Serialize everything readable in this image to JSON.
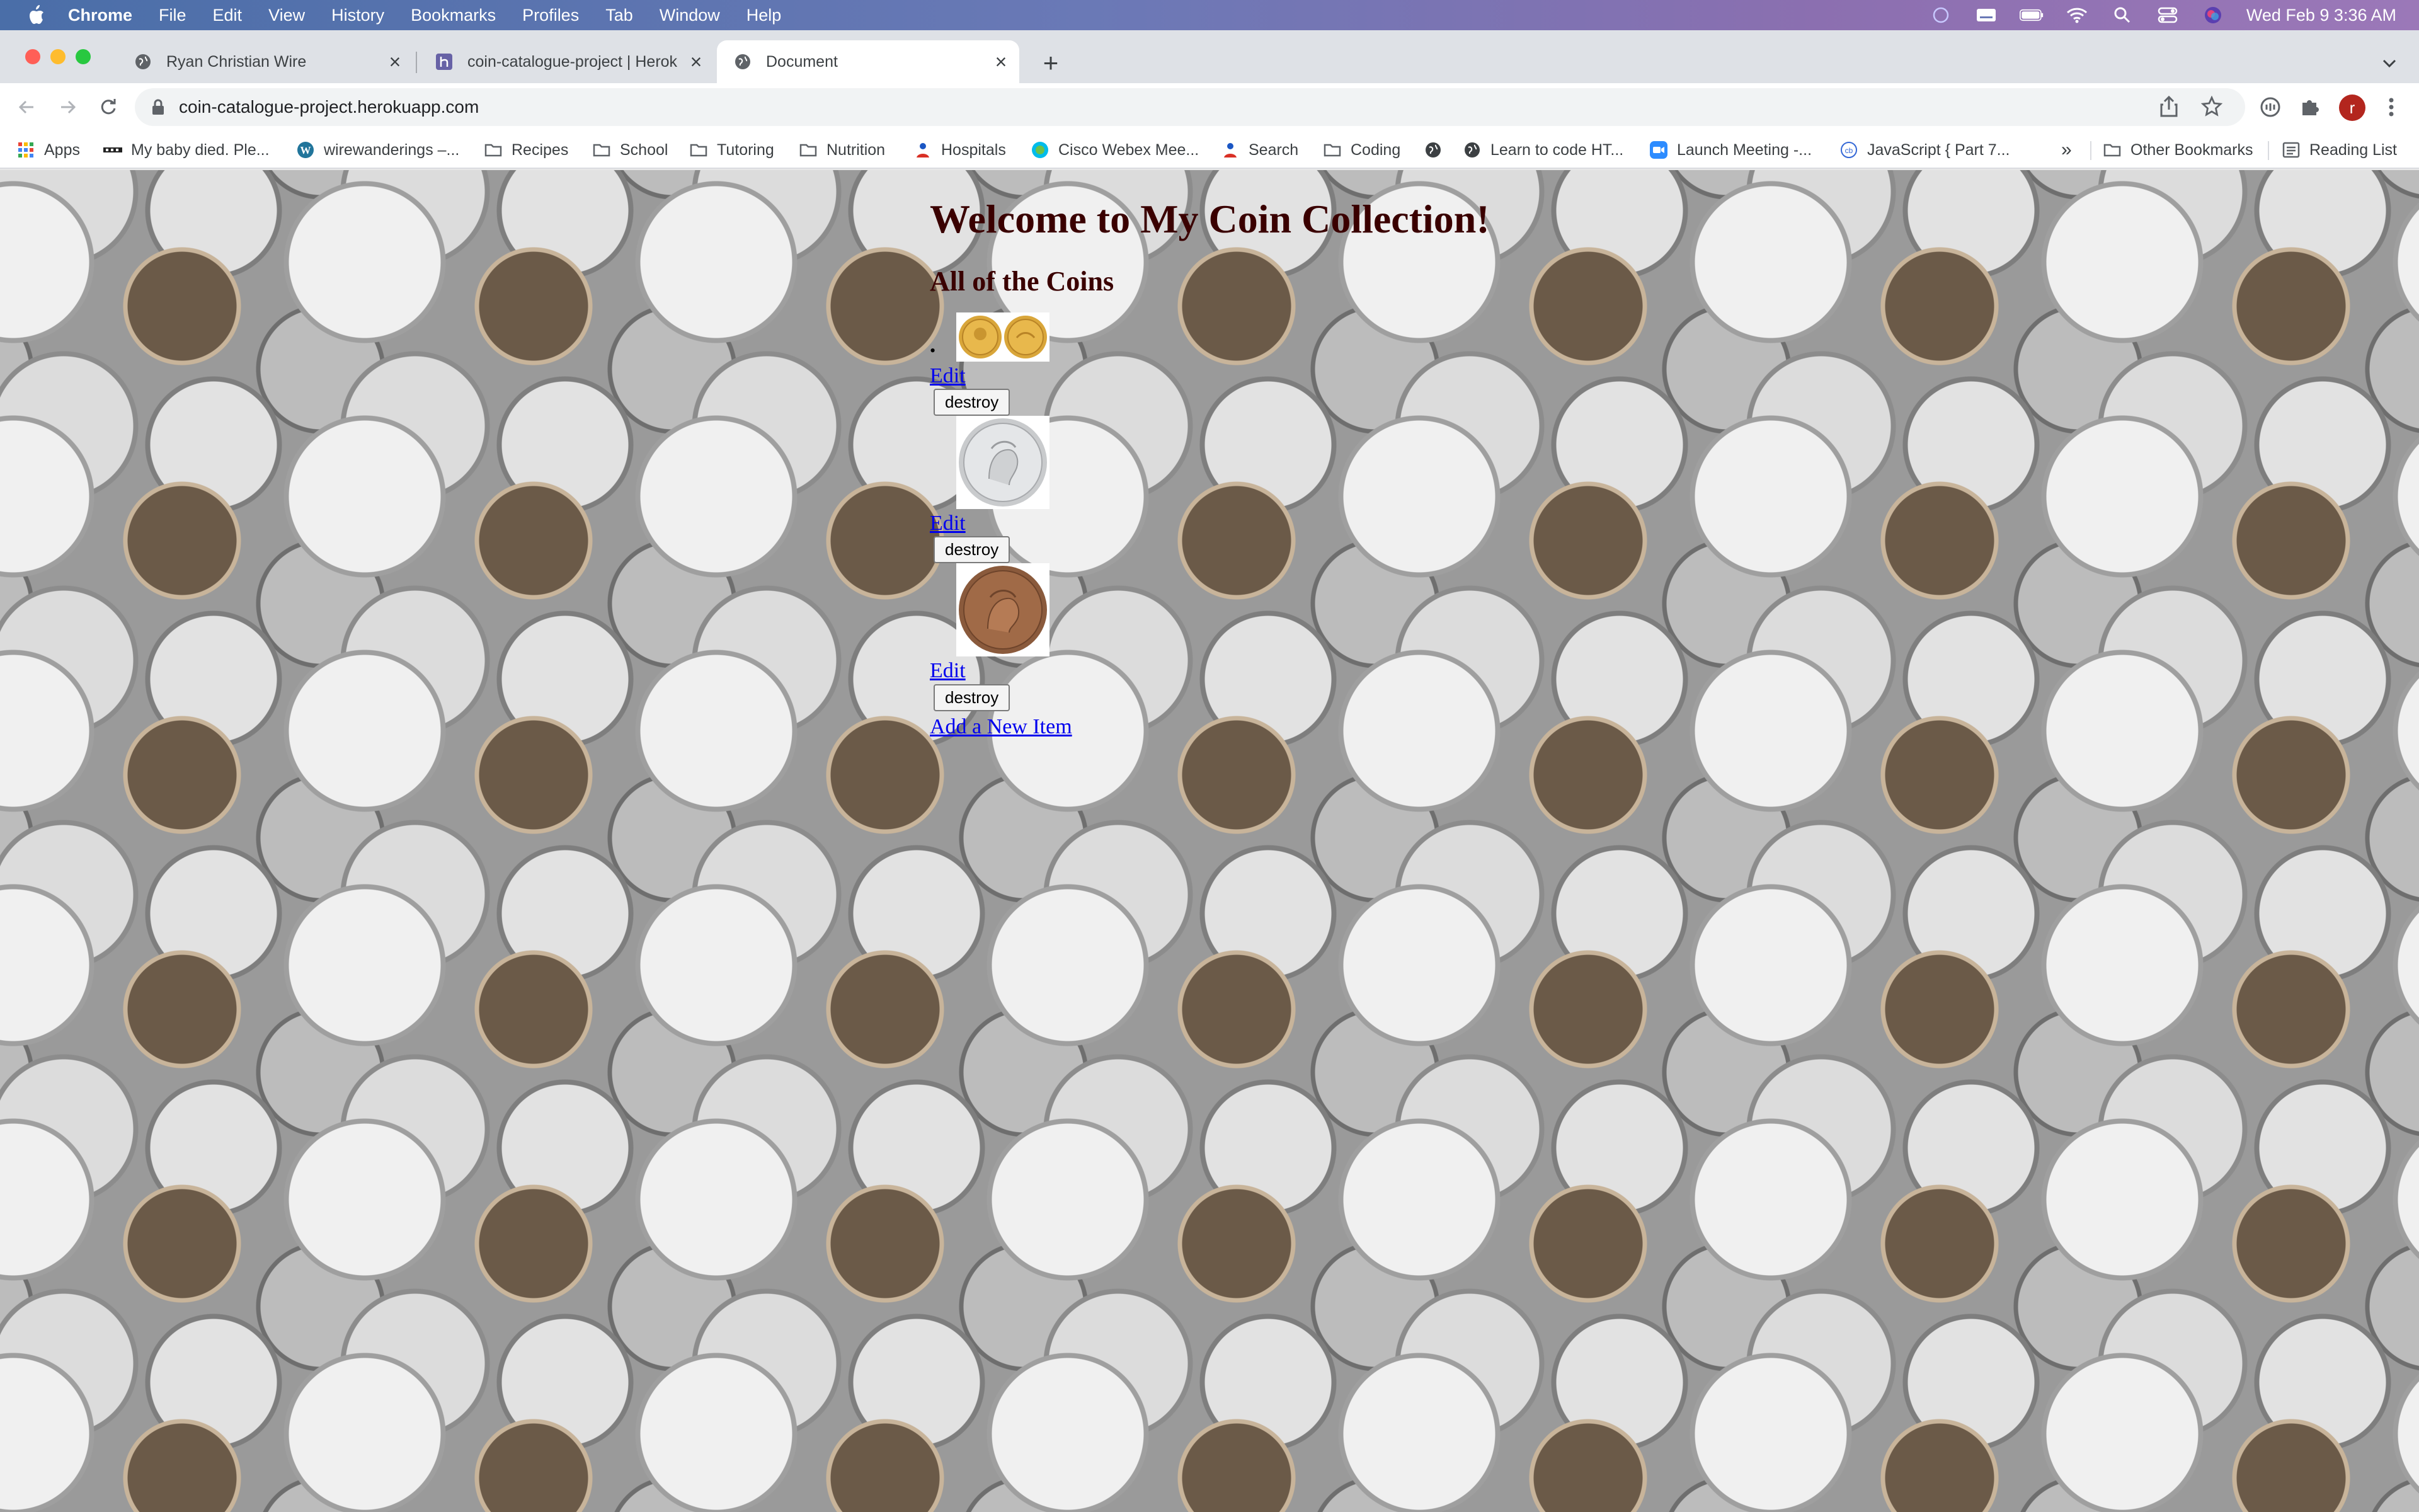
{
  "menubar": {
    "app_name": "Chrome",
    "menus": [
      "File",
      "Edit",
      "View",
      "History",
      "Bookmarks",
      "Profiles",
      "Tab",
      "Window",
      "Help"
    ],
    "clock": "Wed Feb 9  3:36 AM"
  },
  "tabs": [
    {
      "title": "Ryan Christian Wire",
      "icon": "globe-icon",
      "active": false
    },
    {
      "title": "coin-catalogue-project | Herok",
      "icon": "heroku-icon",
      "active": false
    },
    {
      "title": "Document",
      "icon": "globe-icon",
      "active": true
    }
  ],
  "toolbar": {
    "url": "coin-catalogue-project.herokuapp.com",
    "profile_initial": "r"
  },
  "bookmarks": {
    "items": [
      {
        "label": "Apps",
        "icon": "apps-grid-icon"
      },
      {
        "label": "My baby died. Ple...",
        "icon": "gofundme-icon"
      },
      {
        "label": "wirewanderings –...",
        "icon": "wordpress-icon"
      },
      {
        "label": "Recipes",
        "icon": "folder-icon"
      },
      {
        "label": "School",
        "icon": "folder-icon"
      },
      {
        "label": "Tutoring",
        "icon": "folder-icon"
      },
      {
        "label": "Nutrition",
        "icon": "folder-icon"
      },
      {
        "label": "Hospitals",
        "icon": "person-icon"
      },
      {
        "label": "Cisco Webex Mee...",
        "icon": "webex-icon"
      },
      {
        "label": "Search",
        "icon": "person-icon"
      },
      {
        "label": "Coding",
        "icon": "folder-icon"
      },
      {
        "label": "",
        "icon": "globe-icon"
      },
      {
        "label": "Learn to code HT...",
        "icon": "globe-icon"
      },
      {
        "label": "Launch Meeting -...",
        "icon": "zoom-icon"
      },
      {
        "label": "JavaScript { Part 7...",
        "icon": "codebase-icon"
      }
    ],
    "overflow": "»",
    "other_bookmarks": "Other Bookmarks",
    "reading_list": "Reading List"
  },
  "page": {
    "heading": "Welcome to My Coin Collection!",
    "subheading": "All of the Coins",
    "coins": [
      {
        "image": "two-gold-coins",
        "edit": "Edit",
        "destroy": "destroy"
      },
      {
        "image": "silver-coin",
        "edit": "Edit",
        "destroy": "destroy"
      },
      {
        "image": "copper-coin",
        "edit": "Edit",
        "destroy": "destroy"
      }
    ],
    "add_link": "Add a New Item"
  },
  "colors": {
    "heading": "#3a0000",
    "link": "#0000ee",
    "tabstrip": "#dee1e6",
    "profile": "#b3261e"
  }
}
